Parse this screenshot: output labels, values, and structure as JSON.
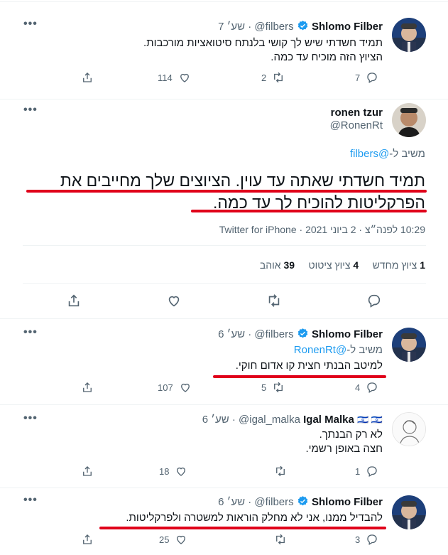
{
  "tweet1": {
    "name": "Shlomo Filber",
    "handle": "@filbers",
    "time": "7 שע׳",
    "line1": "תמיד חשדתי שיש לך קושי בלנתח סיטואציות מורכבות.",
    "line2": "הציוץ הזה מוכיח עד כמה.",
    "replies": "7",
    "retweets": "2",
    "likes": "114"
  },
  "main": {
    "name": "ronen tzur",
    "handle": "@RonenRt",
    "reply_prefix": "משיב ל-",
    "reply_to": "@filbers",
    "line1": "תמיד חשדתי שאתה עד עוין. הציוצים שלך מחייבים את",
    "line2": "הפרקליטות להוכיח לך עד כמה.",
    "timestamp": "10:29 לפנה״צ · 2 ביוני 2021 · Twitter for iPhone",
    "stat1_num": "1",
    "stat1_label": "ציוץ מחדש",
    "stat2_num": "4",
    "stat2_label": "ציוץ ציטוט",
    "stat3_num": "39",
    "stat3_label": "אוהב"
  },
  "tweet2": {
    "name": "Shlomo Filber",
    "handle": "@filbers",
    "time": "6 שע׳",
    "reply_prefix": "משיב ל-",
    "reply_to": "@RonenRt",
    "line1": "למיטב הבנתי חצית קו אדום חוקי.",
    "replies": "4",
    "retweets": "5",
    "likes": "107"
  },
  "tweet3": {
    "name": "Igal Malka",
    "flags": "🇮🇱 🇮🇱",
    "handle": "@igal_malka",
    "time": "6 שע׳",
    "line1": "לא רק הבנתך.",
    "line2": "חצה באופן רשמי.",
    "replies": "1",
    "retweets": "",
    "likes": "18"
  },
  "tweet4": {
    "name": "Shlomo Filber",
    "handle": "@filbers",
    "time": "6 שע׳",
    "line1": "להבדיל ממנו, אני לא מחלק הוראות למשטרה ולפרקליטות.",
    "replies": "3",
    "retweets": "",
    "likes": "25"
  },
  "colors": {
    "accent": "#1d9bf0",
    "underline": "#e0001a",
    "muted": "#536471"
  },
  "icons": [
    "reply-icon",
    "retweet-icon",
    "like-icon",
    "share-icon",
    "verified-icon",
    "more-icon"
  ]
}
